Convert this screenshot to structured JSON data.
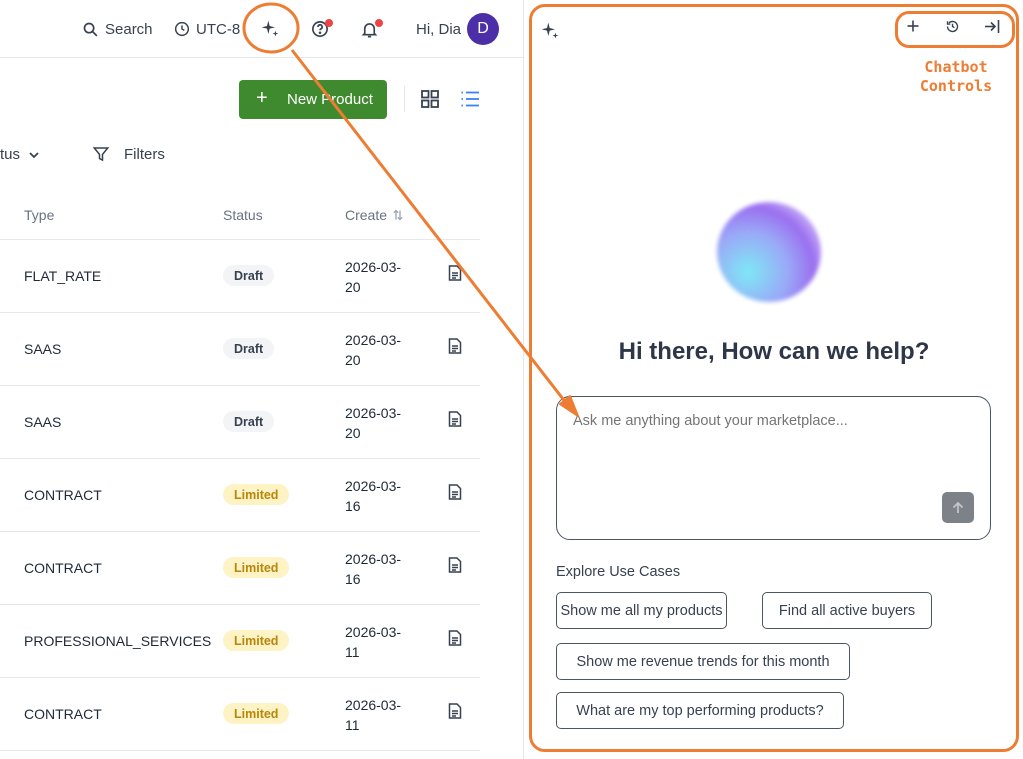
{
  "topbar": {
    "search_label": "Search",
    "timezone_label": "UTC-8",
    "greeting": "Hi, Dia",
    "avatar_initial": "D"
  },
  "toolbar": {
    "new_product_label": "New Product"
  },
  "filters": {
    "status_label": "tus",
    "filters_label": "Filters"
  },
  "table": {
    "columns": [
      "Type",
      "Status",
      "Create"
    ],
    "rows": [
      {
        "type": "FLAT_RATE",
        "status": "Draft",
        "created": "2026-03-20"
      },
      {
        "type": "SAAS",
        "status": "Draft",
        "created": "2026-03-20"
      },
      {
        "type": "SAAS",
        "status": "Draft",
        "created": "2026-03-20"
      },
      {
        "type": "CONTRACT",
        "status": "Limited",
        "created": "2026-03-16"
      },
      {
        "type": "CONTRACT",
        "status": "Limited",
        "created": "2026-03-16"
      },
      {
        "type": "PROFESSIONAL_SERVICES",
        "status": "Limited",
        "created": "2026-03-11"
      },
      {
        "type": "CONTRACT",
        "status": "Limited",
        "created": "2026-03-11"
      }
    ]
  },
  "chatbot": {
    "controls_annotation_line1": "Chatbot",
    "controls_annotation_line2": "Controls",
    "greeting": "Hi there, How can we help?",
    "input_placeholder": "Ask me anything about your marketplace...",
    "explore_title": "Explore Use Cases",
    "use_cases": [
      "Show me all my products",
      "Find all active buyers",
      "Show me revenue trends for this month",
      "What are my top performing products?"
    ]
  },
  "colors": {
    "annotation": "#ee7d33",
    "primary_button": "#3f8a2e",
    "avatar": "#4c2fa8",
    "badge_draft_bg": "#f3f4f6",
    "badge_limited_bg": "#fdf3c4",
    "badge_limited_text": "#b7860b",
    "notification_dot": "#ef4444"
  },
  "icons": {
    "topbar": [
      "search-icon",
      "clock-icon",
      "sparkle-icon",
      "help-icon",
      "bell-icon"
    ],
    "chat_controls": [
      "plus-icon",
      "history-icon",
      "collapse-panel-icon"
    ]
  }
}
